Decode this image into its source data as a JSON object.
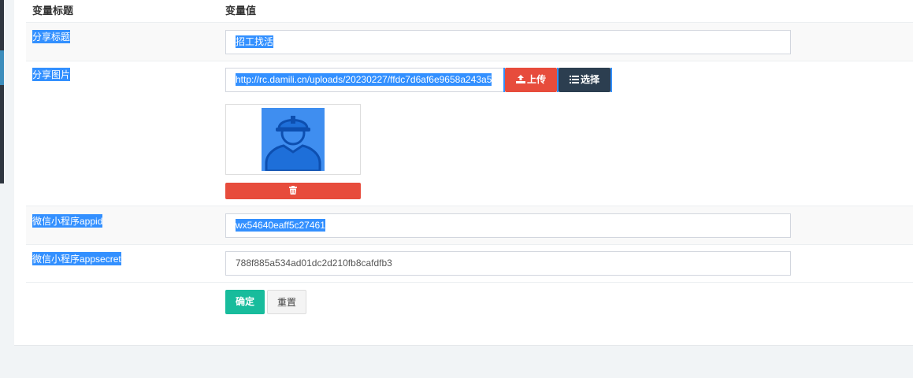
{
  "table": {
    "header": {
      "label_col": "变量标题",
      "value_col": "变量值"
    },
    "rows": {
      "share_title": {
        "label": "分享标题",
        "value": "招工找活"
      },
      "share_image": {
        "label": "分享图片",
        "value": "http://rc.damili.cn/uploads/20230227/ffdc7d6af6e9658a243a5",
        "upload_label": "上传",
        "choose_label": "选择",
        "thumb_icon": "worker-helmet-avatar",
        "delete_icon": "trash-icon"
      },
      "appid": {
        "label": "微信小程序appid",
        "value": "wx54640eaff5c27461"
      },
      "appsecret": {
        "label": "微信小程序appsecret",
        "value": "788f885a534ad01dc2d210fb8cafdfb3"
      }
    },
    "actions": {
      "confirm_label": "确定",
      "reset_label": "重置"
    }
  },
  "colors": {
    "selection": "#3390ff",
    "danger": "#e74c3c",
    "dark": "#2c3e50",
    "success": "#18bc9c"
  }
}
